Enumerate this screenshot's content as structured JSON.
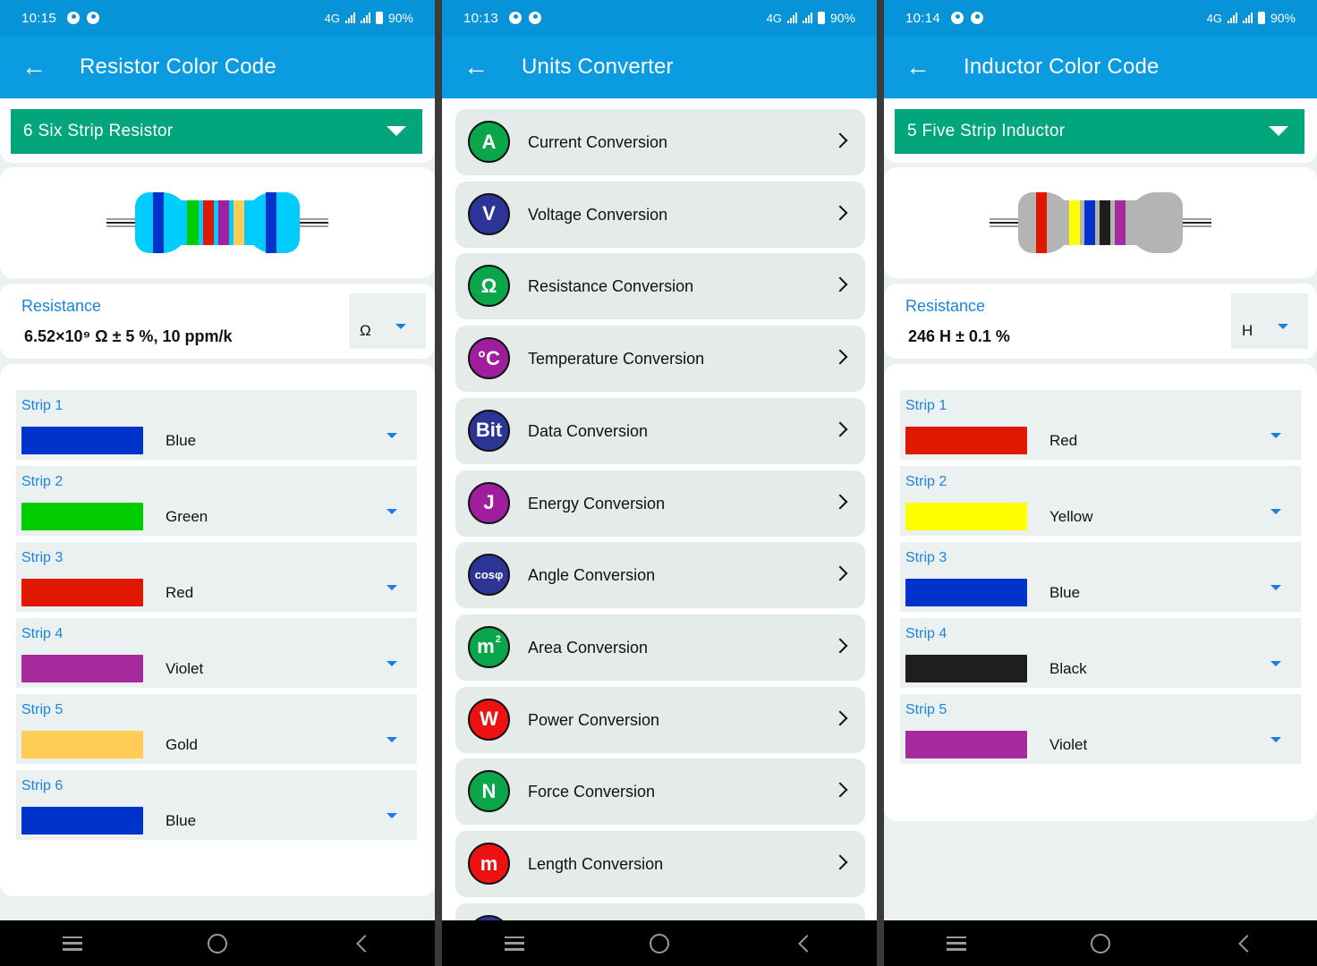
{
  "status_bars": [
    {
      "time": "10:15",
      "network": "4G",
      "battery": "90%"
    },
    {
      "time": "10:13",
      "network": "4G",
      "battery": "90%"
    },
    {
      "time": "10:14",
      "network": "4G",
      "battery": "90%"
    }
  ],
  "resistor_screen": {
    "title": "Resistor Color Code",
    "type_selected": "6 Six Strip Resistor",
    "body_color": "#00ccff",
    "bands": [
      "#0033cc",
      "#00cc00",
      "#e01800",
      "#a020a0",
      "#ffcc55",
      "#0033cc"
    ],
    "result_label": "Resistance",
    "result_value": "6.52×10⁹ Ω  ± 5 %, 10 ppm/k",
    "unit": "Ω",
    "strips": [
      {
        "label": "Strip 1",
        "color_name": "Blue",
        "color": "#0033cc"
      },
      {
        "label": "Strip 2",
        "color_name": "Green",
        "color": "#00cc00"
      },
      {
        "label": "Strip 3",
        "color_name": "Red",
        "color": "#e01800"
      },
      {
        "label": "Strip 4",
        "color_name": "Violet",
        "color": "#a52a9e"
      },
      {
        "label": "Strip 5",
        "color_name": "Gold",
        "color": "#ffcc55"
      },
      {
        "label": "Strip 6",
        "color_name": "Blue",
        "color": "#0033cc"
      }
    ]
  },
  "units_screen": {
    "title": "Units Converter",
    "items": [
      {
        "symbol": "A",
        "label": "Current Conversion",
        "color": "#0aa64a"
      },
      {
        "symbol": "V",
        "label": "Voltage Conversion",
        "color": "#2c3596"
      },
      {
        "symbol": "Ω",
        "label": "Resistance Conversion",
        "color": "#0aa64a"
      },
      {
        "symbol": "°C",
        "label": "Temperature Conversion",
        "color": "#a01e9e"
      },
      {
        "symbol": "Bit",
        "label": "Data Conversion",
        "color": "#2c3596"
      },
      {
        "symbol": "J",
        "label": "Energy Conversion",
        "color": "#a01e9e"
      },
      {
        "symbol": "cosφ",
        "label": "Angle Conversion",
        "color": "#2c3596"
      },
      {
        "symbol": "m",
        "sup": "2",
        "label": "Area Conversion",
        "color": "#0aa64a"
      },
      {
        "symbol": "W",
        "label": "Power Conversion",
        "color": "#ee1111"
      },
      {
        "symbol": "N",
        "label": "Force Conversion",
        "color": "#0aa64a"
      },
      {
        "symbol": "m",
        "label": "Length Conversion",
        "color": "#ee1111"
      },
      {
        "symbol": "",
        "label": "",
        "color": "#2c3596"
      }
    ]
  },
  "inductor_screen": {
    "title": "Inductor Color Code",
    "type_selected": "5 Five Strip Inductor",
    "body_color": "#b4b4b4",
    "bands": [
      "#e01800",
      "#ffff00",
      "#0033cc",
      "#1e1e1e",
      "#a52a9e"
    ],
    "result_label": "Resistance",
    "result_value": "246 H  ± 0.1 %",
    "unit": "H",
    "strips": [
      {
        "label": "Strip 1",
        "color_name": "Red",
        "color": "#e01800"
      },
      {
        "label": "Strip 2",
        "color_name": "Yellow",
        "color": "#ffff00"
      },
      {
        "label": "Strip 3",
        "color_name": "Blue",
        "color": "#0033cc"
      },
      {
        "label": "Strip 4",
        "color_name": "Black",
        "color": "#1e1e1e"
      },
      {
        "label": "Strip 5",
        "color_name": "Violet",
        "color": "#a52a9e"
      }
    ]
  }
}
